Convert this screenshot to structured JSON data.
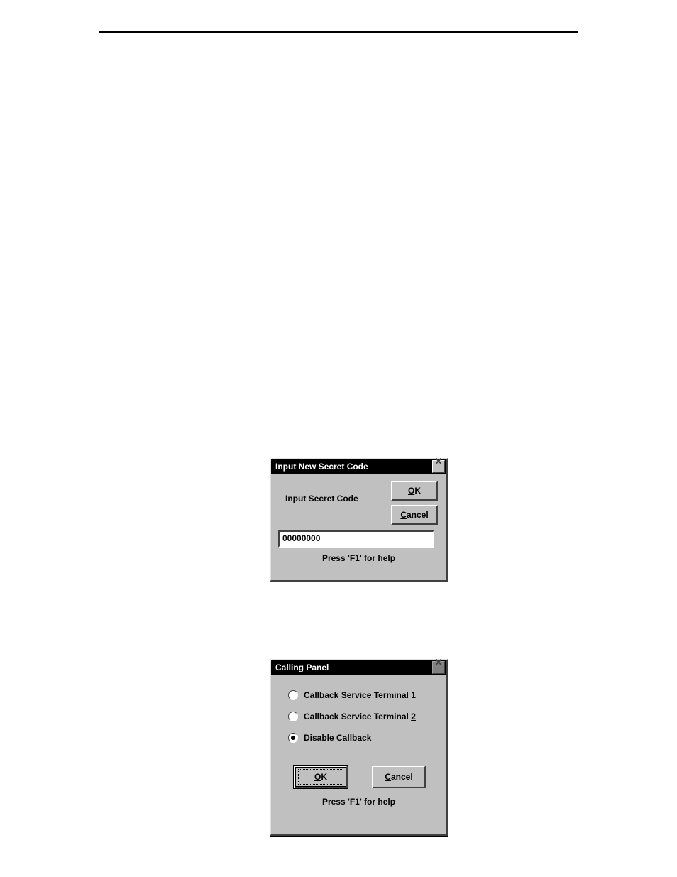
{
  "dialog1": {
    "title": "Input New Secret Code",
    "label": "Input Secret Code",
    "value": "00000000",
    "ok_prefix": "O",
    "ok_rest": "K",
    "cancel_prefix": "C",
    "cancel_rest": "ancel",
    "help": "Press 'F1' for help"
  },
  "dialog2": {
    "title": "Calling Panel",
    "opt1_text": "Callback Service Terminal ",
    "opt1_suffix": "1",
    "opt2_text": "Callback Service Terminal ",
    "opt2_suffix": "2",
    "opt3_text": "Disable Callback",
    "ok_prefix": "O",
    "ok_rest": "K",
    "cancel_prefix": "C",
    "cancel_rest": "ancel",
    "help": "Press 'F1' for help"
  }
}
